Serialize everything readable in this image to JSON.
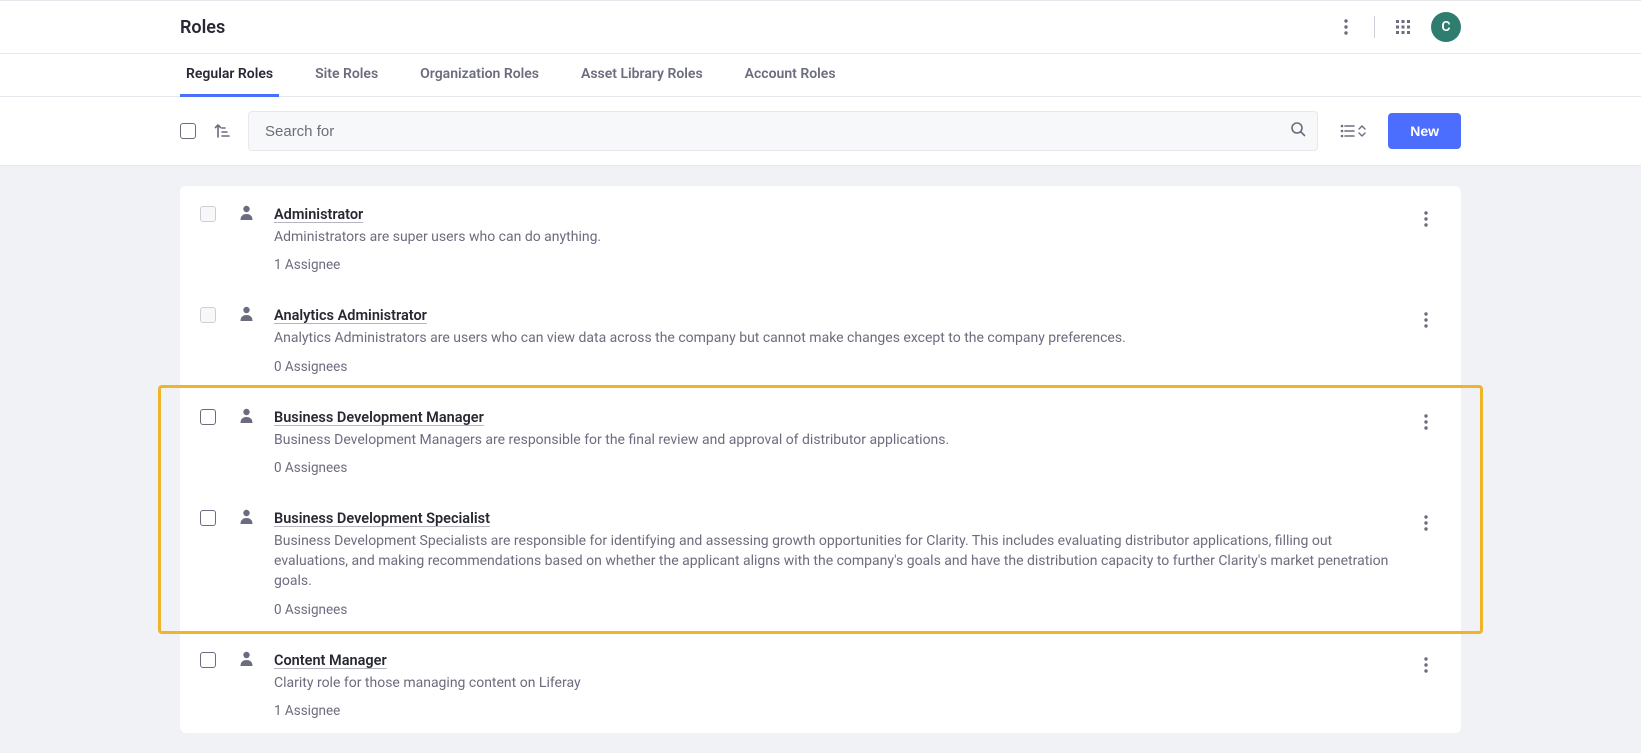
{
  "header": {
    "title": "Roles",
    "avatar_letter": "C"
  },
  "tabs": [
    {
      "label": "Regular Roles",
      "active": true
    },
    {
      "label": "Site Roles",
      "active": false
    },
    {
      "label": "Organization Roles",
      "active": false
    },
    {
      "label": "Asset Library Roles",
      "active": false
    },
    {
      "label": "Account Roles",
      "active": false
    }
  ],
  "toolbar": {
    "search_placeholder": "Search for",
    "new_button": "New"
  },
  "roles": [
    {
      "title": "Administrator",
      "description": "Administrators are super users who can do anything.",
      "assignees": "1 Assignee",
      "selectable": false,
      "highlighted": false
    },
    {
      "title": "Analytics Administrator",
      "description": "Analytics Administrators are users who can view data across the company but cannot make changes except to the company preferences.",
      "assignees": "0 Assignees",
      "selectable": false,
      "highlighted": false
    },
    {
      "title": "Business Development Manager",
      "description": "Business Development Managers are responsible for the final review and approval of distributor applications.",
      "assignees": "0 Assignees",
      "selectable": true,
      "highlighted": true
    },
    {
      "title": "Business Development Specialist",
      "description": "Business Development Specialists are responsible for identifying and assessing growth opportunities for Clarity. This includes evaluating distributor applications, filling out evaluations, and making recommendations based on whether the applicant aligns with the company's goals and have the distribution capacity to further Clarity's market penetration goals.",
      "assignees": "0 Assignees",
      "selectable": true,
      "highlighted": true
    },
    {
      "title": "Content Manager",
      "description": "Clarity role for those managing content on Liferay",
      "assignees": "1 Assignee",
      "selectable": true,
      "highlighted": false
    }
  ]
}
